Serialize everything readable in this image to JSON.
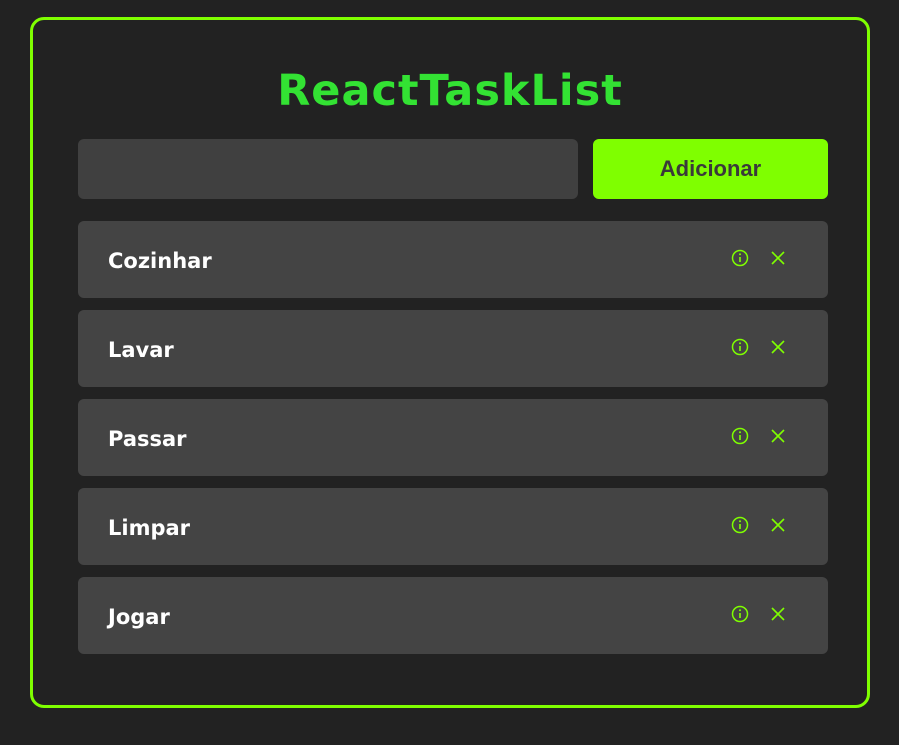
{
  "app": {
    "title": "ReactTaskList"
  },
  "add_form": {
    "input_value": "",
    "input_placeholder": "",
    "button_label": "Adicionar"
  },
  "tasks": [
    {
      "title": "Cozinhar"
    },
    {
      "title": "Lavar"
    },
    {
      "title": "Passar"
    },
    {
      "title": "Limpar"
    },
    {
      "title": "Jogar"
    }
  ],
  "icons": {
    "details": "info-icon",
    "remove": "close-icon"
  },
  "colors": {
    "accent": "#7fff00",
    "title": "#33e233",
    "background": "#222222",
    "card": "#444444",
    "input": "#404040"
  }
}
